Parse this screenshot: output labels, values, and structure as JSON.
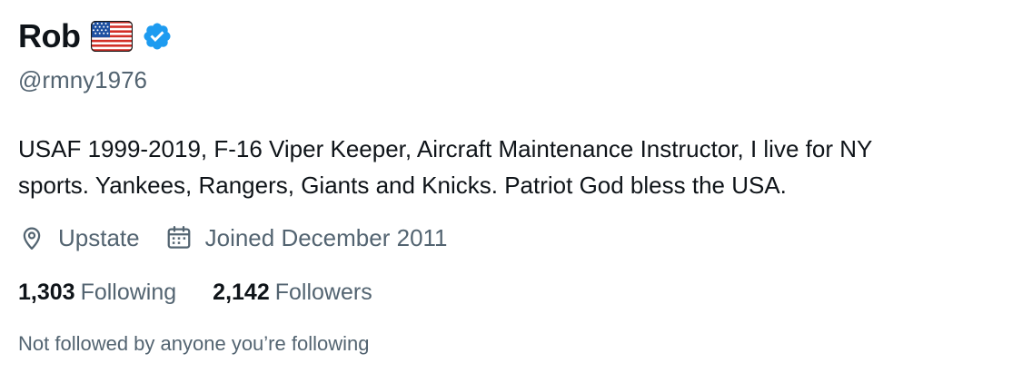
{
  "profile": {
    "display_name": "Rob",
    "flag_icon": "us-flag-icon",
    "verified_icon": "verified-badge-icon",
    "verified_color": "#1d9bf0",
    "handle": "@rmny1976",
    "bio": "USAF 1999-2019, F-16 Viper Keeper, Aircraft Maintenance Instructor, I live for NY\nsports. Yankees, Rangers, Giants and Knicks. Patriot God bless the USA."
  },
  "meta": {
    "location_icon": "location-pin-icon",
    "location": "Upstate",
    "joined_icon": "calendar-icon",
    "joined": "Joined December 2011"
  },
  "stats": {
    "following_count": "1,303",
    "following_label": "Following",
    "followers_count": "2,142",
    "followers_label": "Followers"
  },
  "followed_by": "Not followed by anyone you’re following",
  "colors": {
    "text_primary": "#0f1419",
    "text_secondary": "#536471",
    "accent": "#1d9bf0"
  }
}
